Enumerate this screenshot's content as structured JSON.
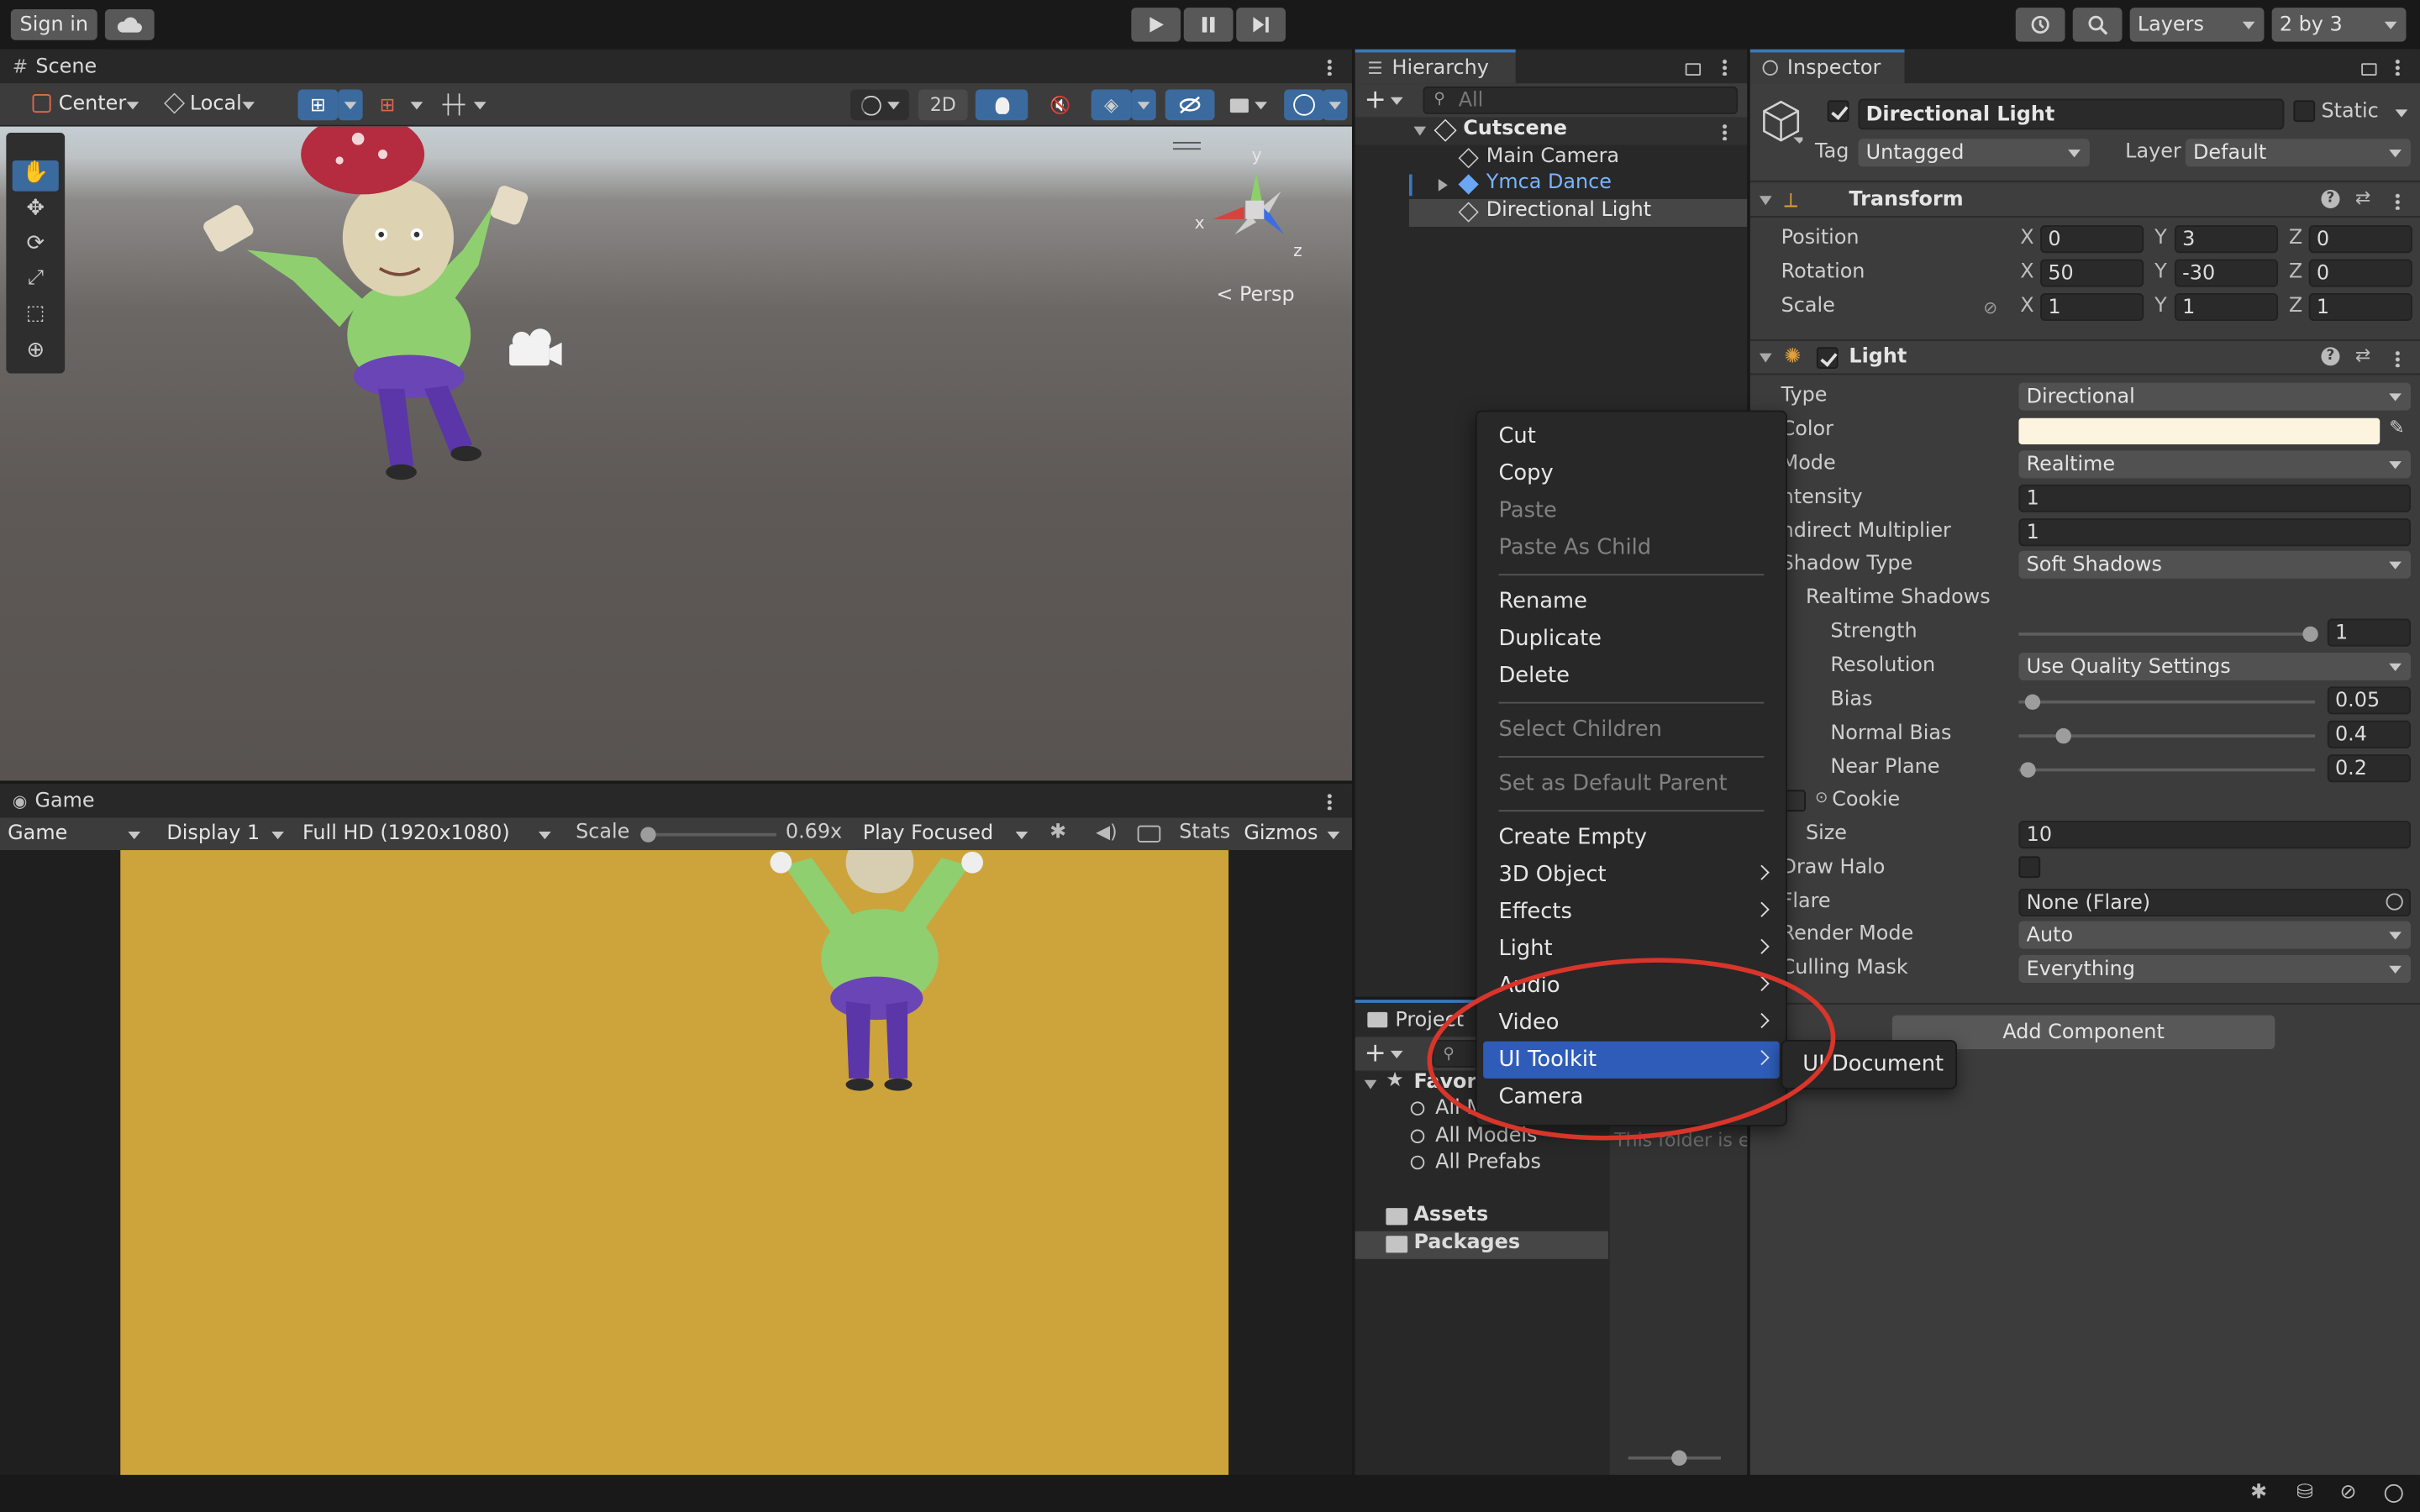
{
  "toolbar": {
    "sign_in": "Sign in",
    "layers": "Layers",
    "layout": "2 by 3"
  },
  "scene": {
    "tab": "Scene",
    "pivot": "Center",
    "space": "Local",
    "mode_2d": "2D",
    "persp": "Persp",
    "axis_x": "x",
    "axis_y": "y",
    "axis_z": "z"
  },
  "game": {
    "tab": "Game",
    "view": "Game",
    "display": "Display 1",
    "resolution": "Full HD (1920x1080)",
    "scale_label": "Scale",
    "scale_value": "0.69x",
    "play_mode": "Play Focused",
    "stats": "Stats",
    "gizmos": "Gizmos",
    "bg_color": "#cda33c"
  },
  "hierarchy": {
    "tab": "Hierarchy",
    "search_placeholder": "All",
    "scene_name": "Cutscene",
    "items": [
      "Main Camera",
      "Ymca Dance",
      "Directional Light"
    ]
  },
  "project": {
    "tab": "Project",
    "favorites": "Favori",
    "fav_items": [
      "All M",
      "All Models",
      "All Prefabs"
    ],
    "assets": "Assets",
    "packages": "Packages",
    "empty_msg": "This folder is e"
  },
  "inspector": {
    "tab": "Inspector",
    "object_name": "Directional Light",
    "static": "Static",
    "tag_label": "Tag",
    "tag_value": "Untagged",
    "layer_label": "Layer",
    "layer_value": "Default",
    "transform": {
      "title": "Transform",
      "position_label": "Position",
      "rotation_label": "Rotation",
      "scale_label": "Scale",
      "position": [
        "0",
        "3",
        "0"
      ],
      "rotation": [
        "50",
        "-30",
        "0"
      ],
      "scale": [
        "1",
        "1",
        "1"
      ]
    },
    "light": {
      "title": "Light",
      "type_label": "Type",
      "type_value": "Directional",
      "color_label": "Color",
      "color_value": "#fdf4df",
      "mode_label": "Mode",
      "mode_value": "Realtime",
      "intensity_label": "ntensity",
      "intensity_value": "1",
      "indirect_label": "ndirect Multiplier",
      "indirect_value": "1",
      "shadow_type_label": "Shadow Type",
      "shadow_type_value": "Soft Shadows",
      "realtime_shadows": "Realtime Shadows",
      "strength_label": "Strength",
      "strength_value": "1",
      "resolution_label": "Resolution",
      "resolution_value": "Use Quality Settings",
      "bias_label": "Bias",
      "bias_value": "0.05",
      "normal_bias_label": "Normal Bias",
      "normal_bias_value": "0.4",
      "near_plane_label": "Near Plane",
      "near_plane_value": "0.2",
      "cookie_label": "Cookie",
      "size_label": "Size",
      "size_value": "10",
      "draw_halo_label": "Draw Halo",
      "flare_label": "Flare",
      "flare_value": "None (Flare)",
      "render_mode_label": "Render Mode",
      "render_mode_value": "Auto",
      "culling_label": "Culling Mask",
      "culling_value": "Everything"
    },
    "add_component": "Add Component"
  },
  "context_menu": {
    "cut": "Cut",
    "copy": "Copy",
    "paste": "Paste",
    "paste_as_child": "Paste As Child",
    "rename": "Rename",
    "duplicate": "Duplicate",
    "delete": "Delete",
    "select_children": "Select Children",
    "set_default_parent": "Set as Default Parent",
    "create_empty": "Create Empty",
    "object_3d": "3D Object",
    "effects": "Effects",
    "light": "Light",
    "audio": "Audio",
    "video": "Video",
    "ui_toolkit": "UI Toolkit",
    "camera": "Camera"
  },
  "submenu": {
    "ui_document": "UI Document"
  },
  "colors": {
    "accent": "#2e5cb8",
    "annotation": "#d9352a",
    "link": "#7ab4ff"
  }
}
